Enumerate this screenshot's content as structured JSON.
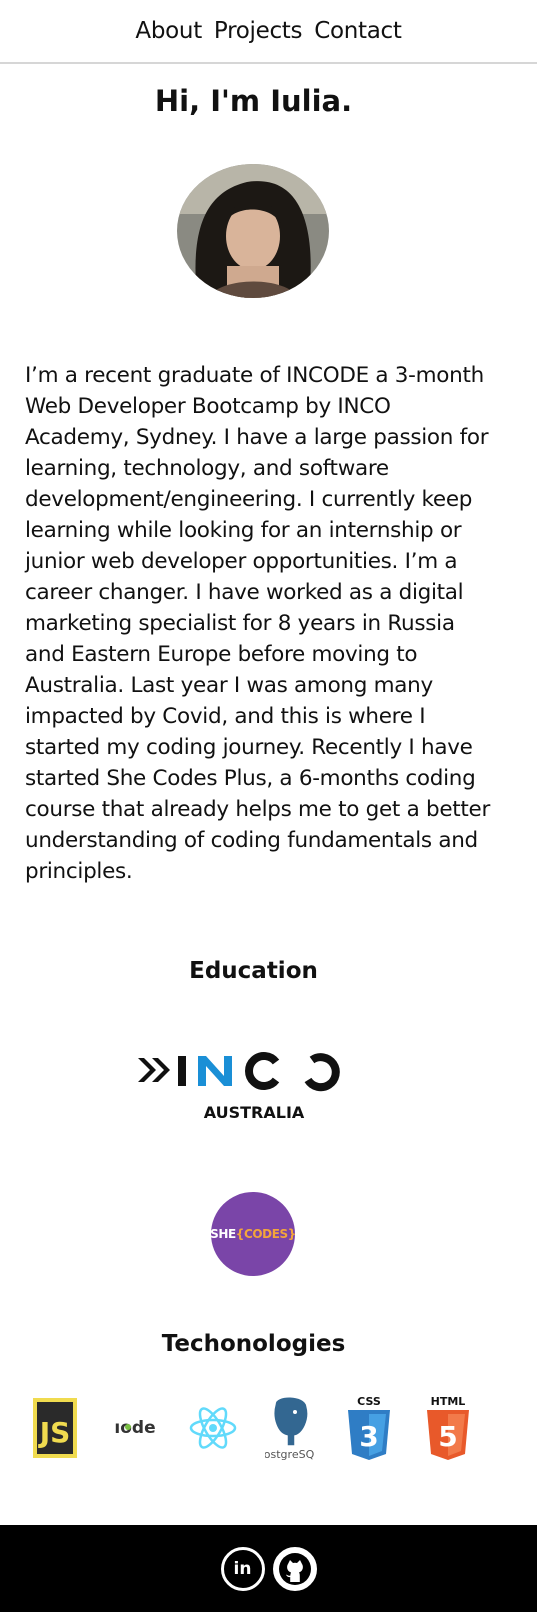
{
  "nav": {
    "items": [
      "About",
      "Projects",
      "Contact"
    ]
  },
  "hero": {
    "title": "Hi, I'm Iulia."
  },
  "bio": "I’m a recent graduate of INCODE a 3-month Web Developer Bootcamp by INCO Academy, Sydney. I have a large passion for learning, technology, and software development/engineering. I currently keep learning while looking for an internship or junior web developer opportunities. I’m a career changer. I have worked as a digital marketing specialist for 8 years in Russia and Eastern Europe before moving to Australia. Last year I was among many impacted by Covid, and this is where I started my coding journey. Recently I have started She Codes Plus, a 6-months coding course that already helps me to get a better understanding of coding fundamentals and principles.",
  "education": {
    "heading": "Education",
    "inco": {
      "name": "INCO",
      "sub": "AUSTRALIA"
    },
    "shecodes": {
      "she": "SHE",
      "codes": "{CODES}"
    }
  },
  "technologies": {
    "heading": "Techonologies",
    "items": [
      {
        "name": "javascript-icon",
        "text": "JS"
      },
      {
        "name": "nodejs-icon",
        "text": "ıode"
      },
      {
        "name": "react-icon",
        "text": ""
      },
      {
        "name": "postgresql-icon",
        "text": "ostgreSQ"
      },
      {
        "name": "css3-icon",
        "text": "CSS"
      },
      {
        "name": "html5-icon",
        "text": "HTML"
      }
    ]
  },
  "footer": {
    "linkedin": "in"
  },
  "colors": {
    "shecodes": "#7a45a8",
    "inco_blue": "#1a8fd6",
    "js": "#f0db4f",
    "css": "#2f7dc5",
    "html": "#e8592a",
    "react": "#61dafb"
  }
}
